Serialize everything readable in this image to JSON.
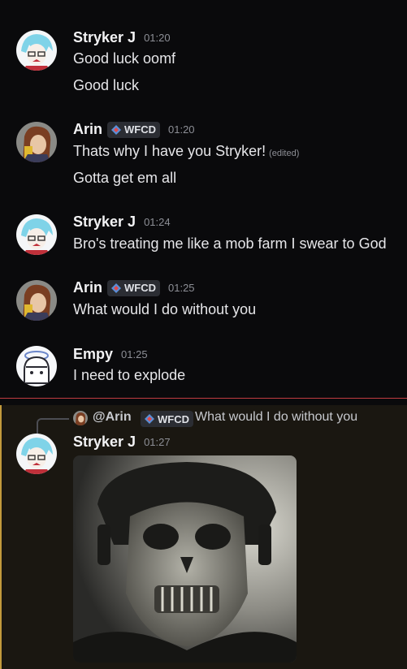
{
  "messages": [
    {
      "author": "Stryker J",
      "time": "01:20",
      "lines": [
        "Good luck oomf",
        "Good luck"
      ]
    },
    {
      "author": "Arin",
      "tag": "WFCD",
      "time": "01:20",
      "lines": [
        "Thats why I have you Stryker!",
        "Gotta get em all"
      ],
      "edited_label": "(edited)"
    },
    {
      "author": "Stryker J",
      "time": "01:24",
      "lines": [
        "Bro's treating me like a mob farm I swear to God"
      ]
    },
    {
      "author": "Arin",
      "tag": "WFCD",
      "time": "01:25",
      "lines": [
        "What would I do without you"
      ]
    },
    {
      "author": "Empy",
      "time": "01:25",
      "lines": [
        "I need to explode"
      ]
    },
    {
      "author": "Stryker J",
      "time": "01:27",
      "reply": {
        "mention": "@Arin",
        "tag": "WFCD",
        "text": "What would I do without you"
      },
      "attachment": "image"
    }
  ],
  "colors": {
    "background": "#0a0a0c",
    "highlight_bg": "#1a1711",
    "highlight_bar": "#c29a3c",
    "new_divider": "#e0444a"
  }
}
